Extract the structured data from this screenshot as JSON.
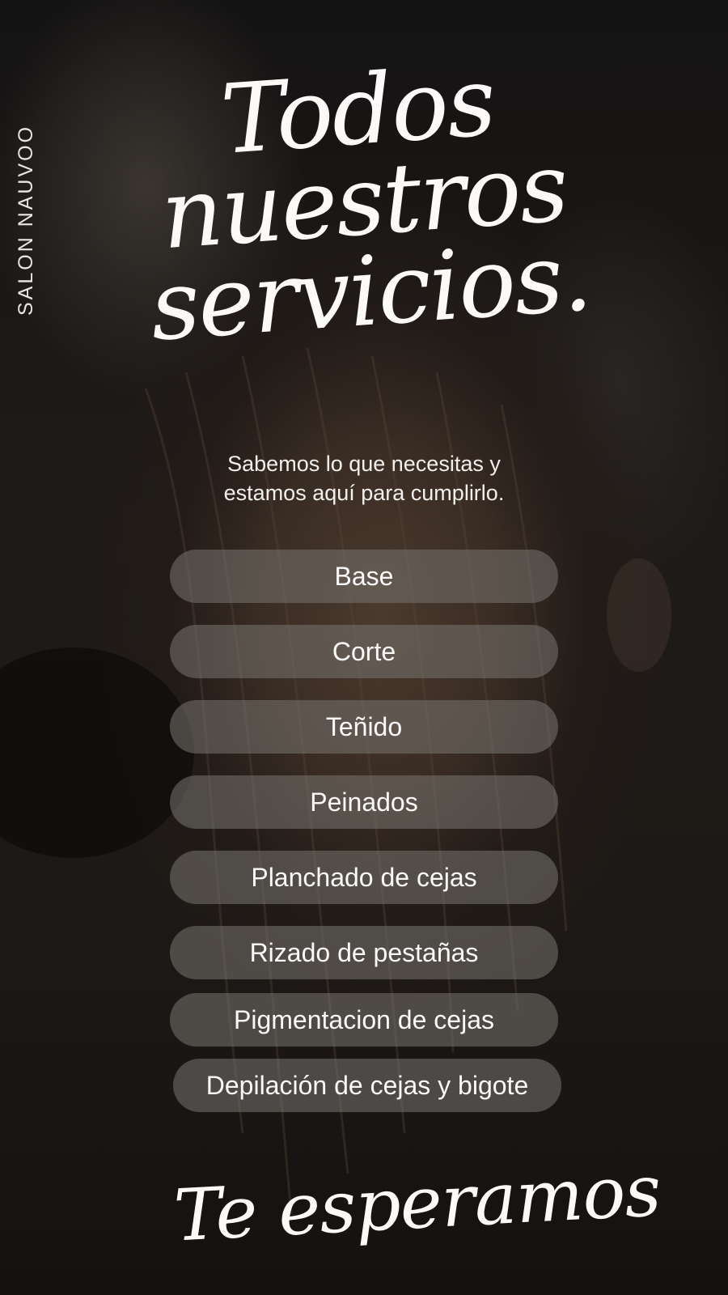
{
  "brand": "SALON NAUVOO",
  "headline": {
    "line1": "Todos",
    "line2": "nuestros",
    "line3": "servicios."
  },
  "subtitle": {
    "line1": "Sabemos lo que necesitas y",
    "line2": "estamos aquí para cumplirlo."
  },
  "services": [
    "Base",
    "Corte",
    "Teñido",
    "Peinados",
    "Planchado de cejas",
    "Rizado de pestañas",
    "Pigmentacion de cejas",
    "Depilación de cejas y bigote"
  ],
  "footer": "Te esperamos",
  "colors": {
    "text": "#fbfaf8",
    "pill_background": "#787470"
  }
}
